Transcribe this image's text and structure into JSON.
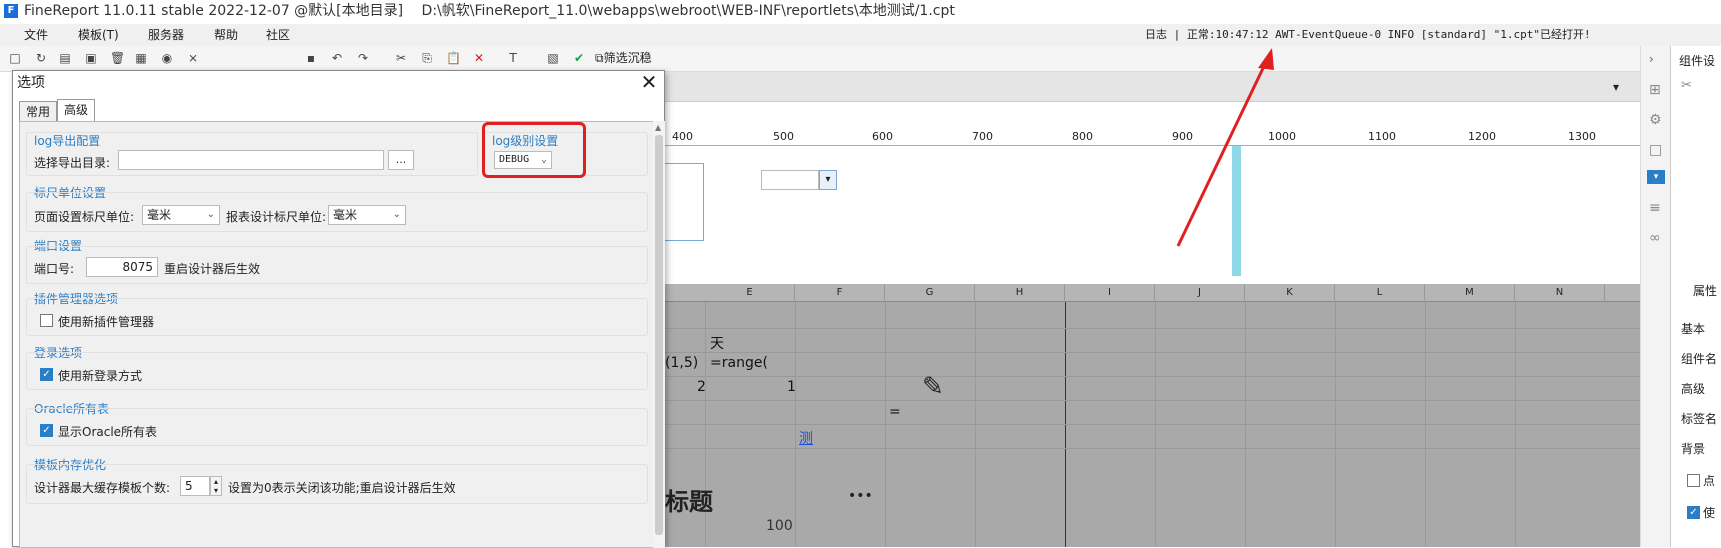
{
  "titlebar": {
    "app": "FineReport 11.0.11 stable 2022-12-07 @默认[本地目录]",
    "path": "D:\\帆软\\FineReport_11.0\\webapps\\webroot\\WEB-INF\\reportlets\\本地测试/1.cpt",
    "logo": "F"
  },
  "menu": [
    "文件",
    "模板(T)",
    "服务器",
    "帮助",
    "社区"
  ],
  "log": {
    "label": "日志 | 正常:",
    "text": "10:47:12 AWT-EventQueue-0 INFO [standard] \"1.cpt\"已经打开!"
  },
  "toolbar": {
    "filter": "筛选沉稳"
  },
  "ruler": [
    "400",
    "500",
    "600",
    "700",
    "800",
    "900",
    "1000",
    "1100",
    "1200",
    "1300"
  ],
  "columns": [
    "E",
    "F",
    "G",
    "H",
    "I",
    "J",
    "K",
    "L",
    "M",
    "N"
  ],
  "cells": {
    "tian": "天",
    "range_left": "(1,5)",
    "range": "=range(",
    "two": "2",
    "one": "1",
    "eq": "=",
    "ce": "测",
    "bigtitle": "标题",
    "dots": "•••",
    "hundred": "100"
  },
  "right_panel": [
    "组件设",
    "属性",
    "基本",
    "组件名",
    "高级",
    "标签名",
    "背景",
    "点",
    "使"
  ],
  "dialog": {
    "title": "选项",
    "close": "✕",
    "tabs": [
      "常用",
      "高级"
    ],
    "log_export": {
      "section": "log导出配置",
      "label": "选择导出目录:",
      "button": "..."
    },
    "log_level": {
      "section": "log级别设置",
      "value": "DEBUG"
    },
    "ruler_unit": {
      "section": "标尺单位设置",
      "page_label": "页面设置标尺单位:",
      "page_value": "毫米",
      "report_label": "报表设计标尺单位:",
      "report_value": "毫米"
    },
    "port": {
      "section": "端口设置",
      "label": "端口号:",
      "value": "8075",
      "note": "重启设计器后生效"
    },
    "plugin": {
      "section": "插件管理器选项",
      "label": "使用新插件管理器",
      "checked": false
    },
    "login": {
      "section": "登录选项",
      "label": "使用新登录方式",
      "checked": true
    },
    "oracle": {
      "section": "Oracle所有表",
      "label": "显示Oracle所有表",
      "checked": true
    },
    "cache": {
      "section": "模板内存优化",
      "label": "设计器最大缓存模板个数:",
      "value": "5",
      "note": "设置为0表示关闭该功能;重启设计器后生效"
    }
  },
  "colors": {
    "accent": "#2a7ec6",
    "highlight": "#e02020",
    "cyan": "#8fd8e8"
  }
}
